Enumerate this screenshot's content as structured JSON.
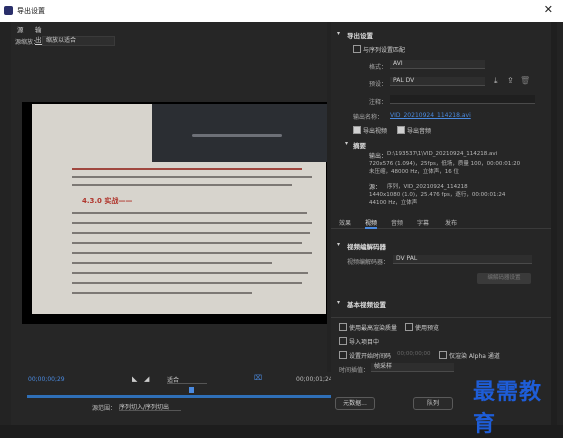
{
  "window": {
    "title": "导出设置",
    "close_glyph": "✕"
  },
  "left_tabs": [
    "源",
    "输出"
  ],
  "source": {
    "label": "源缩放：",
    "value": "缩放以适合"
  },
  "preview": {
    "heading": "4.3.0  实战——"
  },
  "playback": {
    "current_timecode": "00;00;00;29",
    "fit_label": "适合",
    "end_timecode": "00;00;01;24"
  },
  "range": {
    "label": "源范围：",
    "value": "序列切入/序列切出"
  },
  "export": {
    "section_title": "导出设置",
    "match_sequence_label": "与序列设置匹配",
    "format_label": "格式：",
    "format_value": "AVI",
    "preset_label": "预设：",
    "preset_value": "PAL DV",
    "comment_label": "注释：",
    "comment_value": "",
    "output_name_label": "输出名称：",
    "output_name_value": "VID_20210924_114218.avi",
    "export_video_label": "导出视频",
    "export_audio_label": "导出音频"
  },
  "summary": {
    "title": "摘要",
    "output_label": "输出：",
    "output_path": "D:\\193537\\1\\VID_20210924_114218.avi",
    "output_line1": "720x576 (1.094)，25fps，低场，质量 100，00:00:01:20",
    "output_line2": "未压缩，48000 Hz，立体声，16 位",
    "source_label": "源：",
    "source_line0": "序列，VID_20210924_114218",
    "source_line1": "1440x1080 (1.0)，25.476 fps，逐行，00:00:01:24",
    "source_line2": "44100 Hz，立体声"
  },
  "right_tabs": [
    "效果",
    "视频",
    "音频",
    "字幕",
    "发布"
  ],
  "active_right_tab": "视频",
  "video_codec": {
    "section_title": "视频编解码器",
    "codec_label": "视频编解码器：",
    "codec_value": "DV PAL",
    "settings_button": "编解码器设置"
  },
  "basic_video": {
    "section_title": "基本视频设置"
  },
  "options": {
    "max_render_quality": "使用最高渲染质量",
    "use_previews": "使用预览",
    "import_into_project": "导入项目中",
    "set_start_timecode": "设置开始时间码",
    "start_timecode_value": "00;00;00;00",
    "render_alpha": "仅渲染 Alpha 通道",
    "interpolation_label": "时间插值：",
    "interpolation_value": "帧采样"
  },
  "buttons": {
    "metadata": "元数据...",
    "queue": "队列"
  },
  "watermark": "最需教育",
  "colors": {
    "accent": "#4a8ae0",
    "watermark": "#1e5dd8"
  }
}
